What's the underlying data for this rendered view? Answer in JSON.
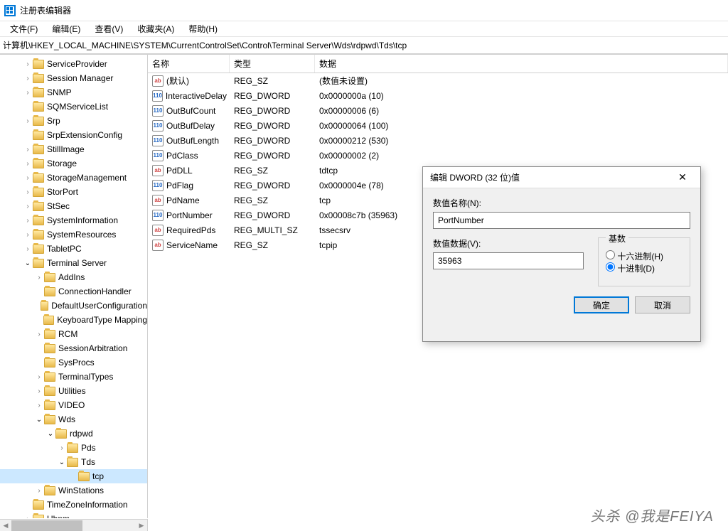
{
  "window": {
    "title": "注册表编辑器"
  },
  "menu": {
    "file": "文件(F)",
    "edit": "编辑(E)",
    "view": "查看(V)",
    "fav": "收藏夹(A)",
    "help": "帮助(H)"
  },
  "address": "计算机\\HKEY_LOCAL_MACHINE\\SYSTEM\\CurrentControlSet\\Control\\Terminal Server\\Wds\\rdpwd\\Tds\\tcp",
  "tree": [
    {
      "indent": 2,
      "arrow": ">",
      "label": "ServiceProvider"
    },
    {
      "indent": 2,
      "arrow": ">",
      "label": "Session Manager"
    },
    {
      "indent": 2,
      "arrow": ">",
      "label": "SNMP"
    },
    {
      "indent": 2,
      "arrow": "",
      "label": "SQMServiceList"
    },
    {
      "indent": 2,
      "arrow": ">",
      "label": "Srp"
    },
    {
      "indent": 2,
      "arrow": "",
      "label": "SrpExtensionConfig"
    },
    {
      "indent": 2,
      "arrow": ">",
      "label": "StillImage"
    },
    {
      "indent": 2,
      "arrow": ">",
      "label": "Storage"
    },
    {
      "indent": 2,
      "arrow": ">",
      "label": "StorageManagement"
    },
    {
      "indent": 2,
      "arrow": ">",
      "label": "StorPort"
    },
    {
      "indent": 2,
      "arrow": ">",
      "label": "StSec"
    },
    {
      "indent": 2,
      "arrow": ">",
      "label": "SystemInformation"
    },
    {
      "indent": 2,
      "arrow": ">",
      "label": "SystemResources"
    },
    {
      "indent": 2,
      "arrow": ">",
      "label": "TabletPC"
    },
    {
      "indent": 2,
      "arrow": "v",
      "label": "Terminal Server"
    },
    {
      "indent": 3,
      "arrow": ">",
      "label": "AddIns"
    },
    {
      "indent": 3,
      "arrow": "",
      "label": "ConnectionHandler"
    },
    {
      "indent": 3,
      "arrow": "",
      "label": "DefaultUserConfiguration"
    },
    {
      "indent": 3,
      "arrow": "",
      "label": "KeyboardType Mapping"
    },
    {
      "indent": 3,
      "arrow": ">",
      "label": "RCM"
    },
    {
      "indent": 3,
      "arrow": "",
      "label": "SessionArbitration"
    },
    {
      "indent": 3,
      "arrow": "",
      "label": "SysProcs"
    },
    {
      "indent": 3,
      "arrow": ">",
      "label": "TerminalTypes"
    },
    {
      "indent": 3,
      "arrow": ">",
      "label": "Utilities"
    },
    {
      "indent": 3,
      "arrow": ">",
      "label": "VIDEO"
    },
    {
      "indent": 3,
      "arrow": "v",
      "label": "Wds"
    },
    {
      "indent": 4,
      "arrow": "v",
      "label": "rdpwd"
    },
    {
      "indent": 5,
      "arrow": ">",
      "label": "Pds"
    },
    {
      "indent": 5,
      "arrow": "v",
      "label": "Tds"
    },
    {
      "indent": 6,
      "arrow": "",
      "label": "tcp",
      "selected": true
    },
    {
      "indent": 3,
      "arrow": ">",
      "label": "WinStations"
    },
    {
      "indent": 2,
      "arrow": "",
      "label": "TimeZoneInformation"
    },
    {
      "indent": 2,
      "arrow": ">",
      "label": "Ubpm"
    }
  ],
  "listHeaders": {
    "name": "名称",
    "type": "类型",
    "data": "数据"
  },
  "values": [
    {
      "icon": "sz",
      "name": "(默认)",
      "type": "REG_SZ",
      "data": "(数值未设置)"
    },
    {
      "icon": "dw",
      "name": "InteractiveDelay",
      "type": "REG_DWORD",
      "data": "0x0000000a (10)"
    },
    {
      "icon": "dw",
      "name": "OutBufCount",
      "type": "REG_DWORD",
      "data": "0x00000006 (6)"
    },
    {
      "icon": "dw",
      "name": "OutBufDelay",
      "type": "REG_DWORD",
      "data": "0x00000064 (100)"
    },
    {
      "icon": "dw",
      "name": "OutBufLength",
      "type": "REG_DWORD",
      "data": "0x00000212 (530)"
    },
    {
      "icon": "dw",
      "name": "PdClass",
      "type": "REG_DWORD",
      "data": "0x00000002 (2)"
    },
    {
      "icon": "sz",
      "name": "PdDLL",
      "type": "REG_SZ",
      "data": "tdtcp"
    },
    {
      "icon": "dw",
      "name": "PdFlag",
      "type": "REG_DWORD",
      "data": "0x0000004e (78)"
    },
    {
      "icon": "sz",
      "name": "PdName",
      "type": "REG_SZ",
      "data": "tcp"
    },
    {
      "icon": "dw",
      "name": "PortNumber",
      "type": "REG_DWORD",
      "data": "0x00008c7b (35963)"
    },
    {
      "icon": "sz",
      "name": "RequiredPds",
      "type": "REG_MULTI_SZ",
      "data": "tssecsrv"
    },
    {
      "icon": "sz",
      "name": "ServiceName",
      "type": "REG_SZ",
      "data": "tcpip"
    }
  ],
  "dialog": {
    "title": "编辑 DWORD (32 位)值",
    "nameLabel": "数值名称(N):",
    "nameValue": "PortNumber",
    "dataLabel": "数值数据(V):",
    "dataValue": "35963",
    "baseLabel": "基数",
    "hex": "十六进制(H)",
    "dec": "十进制(D)",
    "ok": "确定",
    "cancel": "取消"
  },
  "watermark": "头杀 @我是FEIYA"
}
